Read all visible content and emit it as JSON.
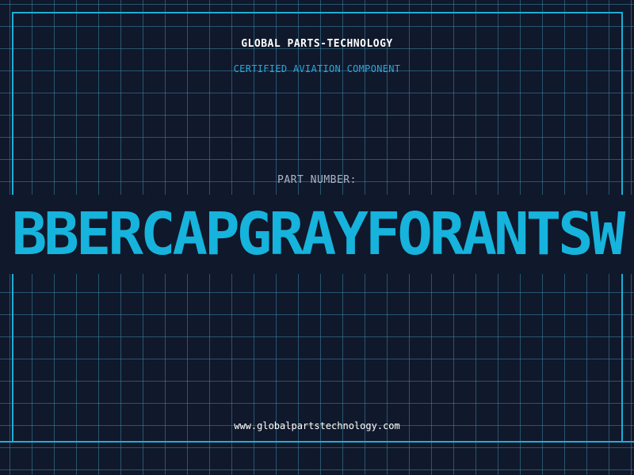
{
  "header": {
    "company": "GLOBAL PARTS-TECHNOLOGY",
    "subtitle": "CERTIFIED AVIATION COMPONENT"
  },
  "part": {
    "label": "PART NUMBER:",
    "value": "BBERCAPGRAYFORANTSW"
  },
  "footer": {
    "url": "www.globalpartstechnology.com"
  },
  "colors": {
    "background": "#10182b",
    "accent": "#1eaed6",
    "part_number": "#16b3dd",
    "subtitle": "#27a8dc",
    "label": "#a9b6c8"
  }
}
